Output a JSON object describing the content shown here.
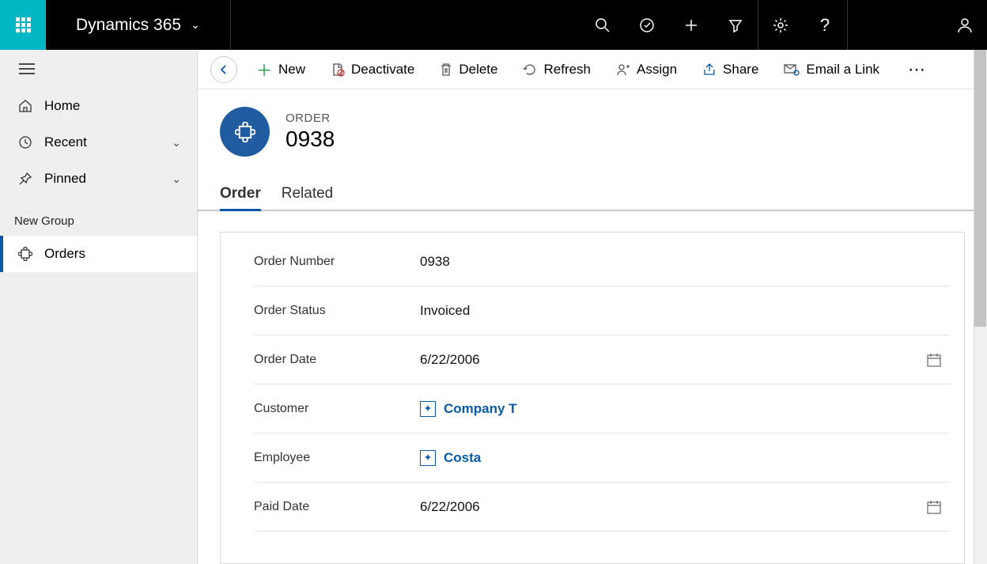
{
  "topbar": {
    "brand": "Dynamics 365"
  },
  "sidebar": {
    "home": "Home",
    "recent": "Recent",
    "pinned": "Pinned",
    "group": "New Group",
    "orders": "Orders"
  },
  "commands": {
    "new": "New",
    "deactivate": "Deactivate",
    "delete": "Delete",
    "refresh": "Refresh",
    "assign": "Assign",
    "share": "Share",
    "email": "Email a Link"
  },
  "record": {
    "entity": "ORDER",
    "title": "0938"
  },
  "tabs": {
    "order": "Order",
    "related": "Related"
  },
  "form": {
    "orderNumber": {
      "label": "Order Number",
      "value": "0938"
    },
    "orderStatus": {
      "label": "Order Status",
      "value": "Invoiced"
    },
    "orderDate": {
      "label": "Order Date",
      "value": "6/22/2006"
    },
    "customer": {
      "label": "Customer",
      "value": "Company T"
    },
    "employee": {
      "label": "Employee",
      "value": "Costa"
    },
    "paidDate": {
      "label": "Paid Date",
      "value": "6/22/2006"
    }
  }
}
